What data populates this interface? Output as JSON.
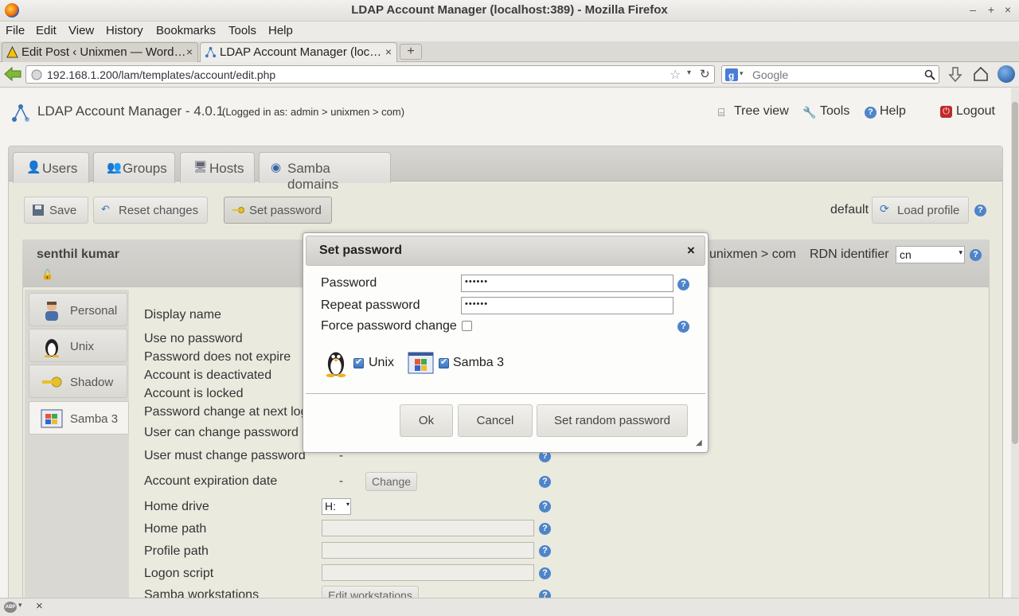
{
  "window": {
    "title": "LDAP Account Manager (localhost:389) - Mozilla Firefox",
    "controls": [
      "–",
      "+",
      "×"
    ]
  },
  "menu": [
    "File",
    "Edit",
    "View",
    "History",
    "Bookmarks",
    "Tools",
    "Help"
  ],
  "browser_tabs": [
    {
      "label": "Edit Post ‹ Unixmen — Word…",
      "close": "×"
    },
    {
      "label": "LDAP Account Manager (loc…",
      "close": "×"
    }
  ],
  "new_tab": "+",
  "url": "192.168.1.200/lam/templates/account/edit.php",
  "search": {
    "placeholder": "Google"
  },
  "app": {
    "title": "LDAP Account Manager - 4.0.1",
    "logged_in": "(Logged in as: admin > unixmen > com)",
    "links": {
      "tree_view": "Tree view",
      "tools": "Tools",
      "help": "Help",
      "logout": "Logout"
    }
  },
  "main_tabs": [
    "Users",
    "Groups",
    "Hosts",
    "Samba domains"
  ],
  "toolbar": {
    "save": "Save",
    "reset": "Reset changes",
    "set_password": "Set password",
    "profile_value": "default",
    "load_profile": "Load profile"
  },
  "account": {
    "name": "senthil kumar",
    "suffix": "unixmen > com",
    "rdn_label": "RDN identifier",
    "rdn_value": "cn"
  },
  "side_tabs": [
    "Personal",
    "Unix",
    "Shadow",
    "Samba 3"
  ],
  "fields": {
    "display_name": "Display name",
    "use_no_password": "Use no password",
    "password_no_expire": "Password does not expire",
    "deactivated": "Account is deactivated",
    "locked": "Account is locked",
    "change_next_login": "Password change at next log",
    "user_can_change": "User can change password",
    "user_must_change": "User must change password",
    "user_must_change_value": "-",
    "expiration": "Account expiration date",
    "expiration_value": "-",
    "change_btn": "Change",
    "home_drive": "Home drive",
    "home_drive_value": "H:",
    "home_path": "Home path",
    "profile_path": "Profile path",
    "logon_script": "Logon script",
    "samba_workstations": "Samba workstations",
    "edit_workstations": "Edit workstations"
  },
  "dialog": {
    "title": "Set password",
    "close": "×",
    "password_label": "Password",
    "password_value": "••••••",
    "repeat_label": "Repeat password",
    "repeat_value": "••••••",
    "force_label": "Force password change",
    "force_checked": false,
    "unix_label": "Unix",
    "unix_checked": true,
    "samba_label": "Samba 3",
    "samba_checked": true,
    "ok": "Ok",
    "cancel": "Cancel",
    "random": "Set random password"
  },
  "status": {
    "abp": "ABP",
    "close": "×"
  },
  "help_glyph": "?",
  "colors": {
    "accent": "#4e84c9",
    "logout": "#c0292a"
  }
}
